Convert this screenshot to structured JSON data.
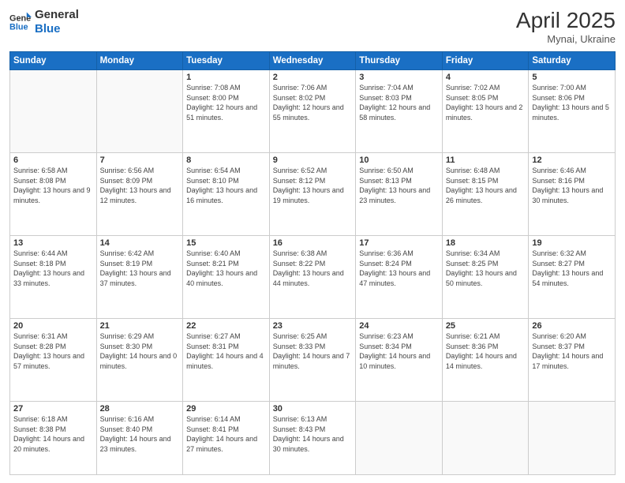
{
  "header": {
    "logo_line1": "General",
    "logo_line2": "Blue",
    "month": "April 2025",
    "location": "Mynai, Ukraine"
  },
  "days_of_week": [
    "Sunday",
    "Monday",
    "Tuesday",
    "Wednesday",
    "Thursday",
    "Friday",
    "Saturday"
  ],
  "weeks": [
    [
      {
        "day": "",
        "info": ""
      },
      {
        "day": "",
        "info": ""
      },
      {
        "day": "1",
        "info": "Sunrise: 7:08 AM\nSunset: 8:00 PM\nDaylight: 12 hours and 51 minutes."
      },
      {
        "day": "2",
        "info": "Sunrise: 7:06 AM\nSunset: 8:02 PM\nDaylight: 12 hours and 55 minutes."
      },
      {
        "day": "3",
        "info": "Sunrise: 7:04 AM\nSunset: 8:03 PM\nDaylight: 12 hours and 58 minutes."
      },
      {
        "day": "4",
        "info": "Sunrise: 7:02 AM\nSunset: 8:05 PM\nDaylight: 13 hours and 2 minutes."
      },
      {
        "day": "5",
        "info": "Sunrise: 7:00 AM\nSunset: 8:06 PM\nDaylight: 13 hours and 5 minutes."
      }
    ],
    [
      {
        "day": "6",
        "info": "Sunrise: 6:58 AM\nSunset: 8:08 PM\nDaylight: 13 hours and 9 minutes."
      },
      {
        "day": "7",
        "info": "Sunrise: 6:56 AM\nSunset: 8:09 PM\nDaylight: 13 hours and 12 minutes."
      },
      {
        "day": "8",
        "info": "Sunrise: 6:54 AM\nSunset: 8:10 PM\nDaylight: 13 hours and 16 minutes."
      },
      {
        "day": "9",
        "info": "Sunrise: 6:52 AM\nSunset: 8:12 PM\nDaylight: 13 hours and 19 minutes."
      },
      {
        "day": "10",
        "info": "Sunrise: 6:50 AM\nSunset: 8:13 PM\nDaylight: 13 hours and 23 minutes."
      },
      {
        "day": "11",
        "info": "Sunrise: 6:48 AM\nSunset: 8:15 PM\nDaylight: 13 hours and 26 minutes."
      },
      {
        "day": "12",
        "info": "Sunrise: 6:46 AM\nSunset: 8:16 PM\nDaylight: 13 hours and 30 minutes."
      }
    ],
    [
      {
        "day": "13",
        "info": "Sunrise: 6:44 AM\nSunset: 8:18 PM\nDaylight: 13 hours and 33 minutes."
      },
      {
        "day": "14",
        "info": "Sunrise: 6:42 AM\nSunset: 8:19 PM\nDaylight: 13 hours and 37 minutes."
      },
      {
        "day": "15",
        "info": "Sunrise: 6:40 AM\nSunset: 8:21 PM\nDaylight: 13 hours and 40 minutes."
      },
      {
        "day": "16",
        "info": "Sunrise: 6:38 AM\nSunset: 8:22 PM\nDaylight: 13 hours and 44 minutes."
      },
      {
        "day": "17",
        "info": "Sunrise: 6:36 AM\nSunset: 8:24 PM\nDaylight: 13 hours and 47 minutes."
      },
      {
        "day": "18",
        "info": "Sunrise: 6:34 AM\nSunset: 8:25 PM\nDaylight: 13 hours and 50 minutes."
      },
      {
        "day": "19",
        "info": "Sunrise: 6:32 AM\nSunset: 8:27 PM\nDaylight: 13 hours and 54 minutes."
      }
    ],
    [
      {
        "day": "20",
        "info": "Sunrise: 6:31 AM\nSunset: 8:28 PM\nDaylight: 13 hours and 57 minutes."
      },
      {
        "day": "21",
        "info": "Sunrise: 6:29 AM\nSunset: 8:30 PM\nDaylight: 14 hours and 0 minutes."
      },
      {
        "day": "22",
        "info": "Sunrise: 6:27 AM\nSunset: 8:31 PM\nDaylight: 14 hours and 4 minutes."
      },
      {
        "day": "23",
        "info": "Sunrise: 6:25 AM\nSunset: 8:33 PM\nDaylight: 14 hours and 7 minutes."
      },
      {
        "day": "24",
        "info": "Sunrise: 6:23 AM\nSunset: 8:34 PM\nDaylight: 14 hours and 10 minutes."
      },
      {
        "day": "25",
        "info": "Sunrise: 6:21 AM\nSunset: 8:36 PM\nDaylight: 14 hours and 14 minutes."
      },
      {
        "day": "26",
        "info": "Sunrise: 6:20 AM\nSunset: 8:37 PM\nDaylight: 14 hours and 17 minutes."
      }
    ],
    [
      {
        "day": "27",
        "info": "Sunrise: 6:18 AM\nSunset: 8:38 PM\nDaylight: 14 hours and 20 minutes."
      },
      {
        "day": "28",
        "info": "Sunrise: 6:16 AM\nSunset: 8:40 PM\nDaylight: 14 hours and 23 minutes."
      },
      {
        "day": "29",
        "info": "Sunrise: 6:14 AM\nSunset: 8:41 PM\nDaylight: 14 hours and 27 minutes."
      },
      {
        "day": "30",
        "info": "Sunrise: 6:13 AM\nSunset: 8:43 PM\nDaylight: 14 hours and 30 minutes."
      },
      {
        "day": "",
        "info": ""
      },
      {
        "day": "",
        "info": ""
      },
      {
        "day": "",
        "info": ""
      }
    ]
  ]
}
